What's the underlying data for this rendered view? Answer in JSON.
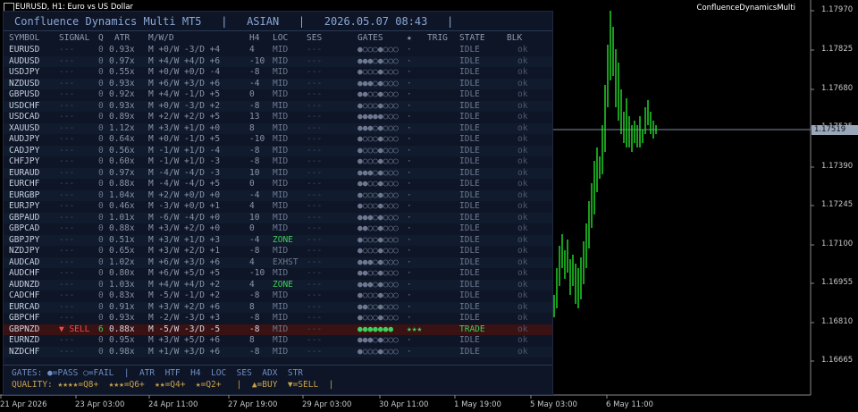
{
  "chart": {
    "title": "EURUSD, H1: Euro vs US Dollar",
    "indicator": "ConfluenceDynamicsMulti",
    "current_price": "1.17519",
    "y_ticks": [
      "1.17970",
      "1.17825",
      "1.17680",
      "1.17535",
      "1.17390",
      "1.17245",
      "1.17100",
      "1.16955",
      "1.16810",
      "1.16665"
    ],
    "x_ticks": [
      "21 Apr 2026",
      "23 Apr 03:00",
      "24 Apr 11:00",
      "27 Apr 19:00",
      "29 Apr 03:00",
      "30 Apr 11:00",
      "1 May 19:00",
      "5 May 03:00",
      "6 May 11:00"
    ]
  },
  "panel": {
    "header": "Confluence Dynamics Multi MT5   |   ASIAN   |   2026.05.07 08:43   |",
    "columns": {
      "symbol": "SYMBOL",
      "signal": "SIGNAL",
      "q": "Q",
      "atr": "ATR",
      "mwd": "M/W/D",
      "h4": "H4",
      "loc": "LOC",
      "ses": "SES",
      "gates": "GATES",
      "star": "★",
      "trig": "TRIG",
      "state": "STATE",
      "blk": "BLK"
    },
    "rows": [
      {
        "symbol": "EURUSD",
        "signal": "---",
        "q": "0",
        "atr": "0.93x",
        "mwd": "M +0/W -3/D +4",
        "h4": "4",
        "loc": "MID",
        "ses": "---",
        "gates": "●○○○●○○○",
        "star": "·",
        "trig": "",
        "state": "IDLE",
        "blk": "ok"
      },
      {
        "symbol": "AUDUSD",
        "signal": "---",
        "q": "0",
        "atr": "0.97x",
        "mwd": "M +4/W +4/D +6",
        "h4": "-10",
        "loc": "MID",
        "ses": "---",
        "gates": "●●●○●○○○",
        "star": "·",
        "trig": "",
        "state": "IDLE",
        "blk": "ok"
      },
      {
        "symbol": "USDJPY",
        "signal": "---",
        "q": "0",
        "atr": "0.55x",
        "mwd": "M +0/W +0/D -4",
        "h4": "-8",
        "loc": "MID",
        "ses": "---",
        "gates": "●○○○●○○○",
        "star": "·",
        "trig": "",
        "state": "IDLE",
        "blk": "ok"
      },
      {
        "symbol": "NZDUSD",
        "signal": "---",
        "q": "0",
        "atr": "0.93x",
        "mwd": "M +6/W +3/D +6",
        "h4": "-4",
        "loc": "MID",
        "ses": "---",
        "gates": "●●●○●○○○",
        "star": "·",
        "trig": "",
        "state": "IDLE",
        "blk": "ok"
      },
      {
        "symbol": "GBPUSD",
        "signal": "---",
        "q": "0",
        "atr": "0.92x",
        "mwd": "M +4/W -1/D +5",
        "h4": "0",
        "loc": "MID",
        "ses": "---",
        "gates": "●●○○●○○○",
        "star": "·",
        "trig": "",
        "state": "IDLE",
        "blk": "ok"
      },
      {
        "symbol": "USDCHF",
        "signal": "---",
        "q": "0",
        "atr": "0.93x",
        "mwd": "M +0/W -3/D +2",
        "h4": "-8",
        "loc": "MID",
        "ses": "---",
        "gates": "●○○○●○○○",
        "star": "·",
        "trig": "",
        "state": "IDLE",
        "blk": "ok"
      },
      {
        "symbol": "USDCAD",
        "signal": "---",
        "q": "0",
        "atr": "0.89x",
        "mwd": "M +2/W +2/D +5",
        "h4": "13",
        "loc": "MID",
        "ses": "---",
        "gates": "●●●●●○○○",
        "star": "·",
        "trig": "",
        "state": "IDLE",
        "blk": "ok"
      },
      {
        "symbol": "XAUUSD",
        "signal": "---",
        "q": "0",
        "atr": "1.12x",
        "mwd": "M +3/W +1/D +0",
        "h4": "8",
        "loc": "MID",
        "ses": "---",
        "gates": "●●●○●○○○",
        "star": "·",
        "trig": "",
        "state": "IDLE",
        "blk": "ok"
      },
      {
        "symbol": "AUDJPY",
        "signal": "---",
        "q": "0",
        "atr": "0.64x",
        "mwd": "M +0/W -1/D +5",
        "h4": "-10",
        "loc": "MID",
        "ses": "---",
        "gates": "●○○○●○○○",
        "star": "·",
        "trig": "",
        "state": "IDLE",
        "blk": "ok"
      },
      {
        "symbol": "CADJPY",
        "signal": "---",
        "q": "0",
        "atr": "0.56x",
        "mwd": "M -1/W +1/D -4",
        "h4": "-8",
        "loc": "MID",
        "ses": "---",
        "gates": "●○○○●○○○",
        "star": "·",
        "trig": "",
        "state": "IDLE",
        "blk": "ok"
      },
      {
        "symbol": "CHFJPY",
        "signal": "---",
        "q": "0",
        "atr": "0.60x",
        "mwd": "M -1/W +1/D -3",
        "h4": "-8",
        "loc": "MID",
        "ses": "---",
        "gates": "●○○○●○○○",
        "star": "·",
        "trig": "",
        "state": "IDLE",
        "blk": "ok"
      },
      {
        "symbol": "EURAUD",
        "signal": "---",
        "q": "0",
        "atr": "0.97x",
        "mwd": "M -4/W -4/D -3",
        "h4": "10",
        "loc": "MID",
        "ses": "---",
        "gates": "●●●○●○○○",
        "star": "·",
        "trig": "",
        "state": "IDLE",
        "blk": "ok"
      },
      {
        "symbol": "EURCHF",
        "signal": "---",
        "q": "0",
        "atr": "0.88x",
        "mwd": "M -4/W -4/D +5",
        "h4": "0",
        "loc": "MID",
        "ses": "---",
        "gates": "●●○○●○○○",
        "star": "·",
        "trig": "",
        "state": "IDLE",
        "blk": "ok"
      },
      {
        "symbol": "EURGBP",
        "signal": "---",
        "q": "0",
        "atr": "1.04x",
        "mwd": "M +2/W +0/D +0",
        "h4": "-4",
        "loc": "MID",
        "ses": "---",
        "gates": "●○○○●○○○",
        "star": "·",
        "trig": "",
        "state": "IDLE",
        "blk": "ok"
      },
      {
        "symbol": "EURJPY",
        "signal": "---",
        "q": "0",
        "atr": "0.46x",
        "mwd": "M -3/W +0/D +1",
        "h4": "4",
        "loc": "MID",
        "ses": "---",
        "gates": "●○○○●○○○",
        "star": "·",
        "trig": "",
        "state": "IDLE",
        "blk": "ok"
      },
      {
        "symbol": "GBPAUD",
        "signal": "---",
        "q": "0",
        "atr": "1.01x",
        "mwd": "M -6/W -4/D +0",
        "h4": "10",
        "loc": "MID",
        "ses": "---",
        "gates": "●●●○●○○○",
        "star": "·",
        "trig": "",
        "state": "IDLE",
        "blk": "ok"
      },
      {
        "symbol": "GBPCAD",
        "signal": "---",
        "q": "0",
        "atr": "0.88x",
        "mwd": "M +3/W +2/D +0",
        "h4": "0",
        "loc": "MID",
        "ses": "---",
        "gates": "●●○○●○○○",
        "star": "·",
        "trig": "",
        "state": "IDLE",
        "blk": "ok"
      },
      {
        "symbol": "GBPJPY",
        "signal": "---",
        "q": "0",
        "atr": "0.51x",
        "mwd": "M +3/W +1/D +3",
        "h4": "-4",
        "loc": "ZONE",
        "ses": "---",
        "gates": "●○○○●○○○",
        "star": "·",
        "trig": "",
        "state": "IDLE",
        "blk": "ok"
      },
      {
        "symbol": "NZDJPY",
        "signal": "---",
        "q": "0",
        "atr": "0.65x",
        "mwd": "M +3/W +2/D +1",
        "h4": "-8",
        "loc": "MID",
        "ses": "---",
        "gates": "●○○○●○○○",
        "star": "·",
        "trig": "",
        "state": "IDLE",
        "blk": "ok"
      },
      {
        "symbol": "AUDCAD",
        "signal": "---",
        "q": "0",
        "atr": "1.02x",
        "mwd": "M +6/W +3/D +6",
        "h4": "4",
        "loc": "EXHST",
        "ses": "---",
        "gates": "●●●○●○○○",
        "star": "·",
        "trig": "",
        "state": "IDLE",
        "blk": "ok"
      },
      {
        "symbol": "AUDCHF",
        "signal": "---",
        "q": "0",
        "atr": "0.80x",
        "mwd": "M +6/W +5/D +5",
        "h4": "-10",
        "loc": "MID",
        "ses": "---",
        "gates": "●●○○●○○○",
        "star": "·",
        "trig": "",
        "state": "IDLE",
        "blk": "ok"
      },
      {
        "symbol": "AUDNZD",
        "signal": "---",
        "q": "0",
        "atr": "1.03x",
        "mwd": "M +4/W +4/D +2",
        "h4": "4",
        "loc": "ZONE",
        "ses": "---",
        "gates": "●●●○●○○○",
        "star": "·",
        "trig": "",
        "state": "IDLE",
        "blk": "ok"
      },
      {
        "symbol": "CADCHF",
        "signal": "---",
        "q": "0",
        "atr": "0.83x",
        "mwd": "M -5/W -1/D +2",
        "h4": "-8",
        "loc": "MID",
        "ses": "---",
        "gates": "●○○○●○○○",
        "star": "·",
        "trig": "",
        "state": "IDLE",
        "blk": "ok"
      },
      {
        "symbol": "EURCAD",
        "signal": "---",
        "q": "0",
        "atr": "0.91x",
        "mwd": "M +3/W +2/D +6",
        "h4": "8",
        "loc": "MID",
        "ses": "---",
        "gates": "●●○○●○○○",
        "star": "·",
        "trig": "",
        "state": "IDLE",
        "blk": "ok"
      },
      {
        "symbol": "GBPCHF",
        "signal": "---",
        "q": "0",
        "atr": "0.93x",
        "mwd": "M -2/W -3/D +3",
        "h4": "-8",
        "loc": "MID",
        "ses": "---",
        "gates": "●○○○●○○○",
        "star": "·",
        "trig": "",
        "state": "IDLE",
        "blk": "ok"
      },
      {
        "symbol": "GBPNZD",
        "signal": "▼ SELL",
        "q": "6",
        "atr": "0.88x",
        "mwd": "M -5/W -3/D -5",
        "h4": "-8",
        "loc": "MID",
        "ses": "---",
        "gates": "●●●●●●●",
        "star": "★★★",
        "trig": "",
        "state": "TRADE",
        "blk": "ok",
        "active": true
      },
      {
        "symbol": "EURNZD",
        "signal": "---",
        "q": "0",
        "atr": "0.95x",
        "mwd": "M +3/W +5/D +6",
        "h4": "8",
        "loc": "MID",
        "ses": "---",
        "gates": "●●●○●○○○",
        "star": "·",
        "trig": "",
        "state": "IDLE",
        "blk": "ok"
      },
      {
        "symbol": "NZDCHF",
        "signal": "---",
        "q": "0",
        "atr": "0.98x",
        "mwd": "M +1/W +3/D +6",
        "h4": "-8",
        "loc": "MID",
        "ses": "---",
        "gates": "●○○○●○○○",
        "star": "·",
        "trig": "",
        "state": "IDLE",
        "blk": "ok"
      }
    ],
    "footer_line1": "GATES: ●=PASS ○=FAIL  |  ATR  HTF  H4  LOC  SES  ADX  STR",
    "footer_line2": "QUALITY: ★★★★=Q8+  ★★★=Q6+  ★★=Q4+  ★=Q2+   |  ▲=BUY  ▼=SELL  |"
  },
  "colors": {
    "buy": "#3ecf5a",
    "sell": "#ef4b4b",
    "panel_bg": "#0d1526",
    "candle": "#22e02a"
  }
}
